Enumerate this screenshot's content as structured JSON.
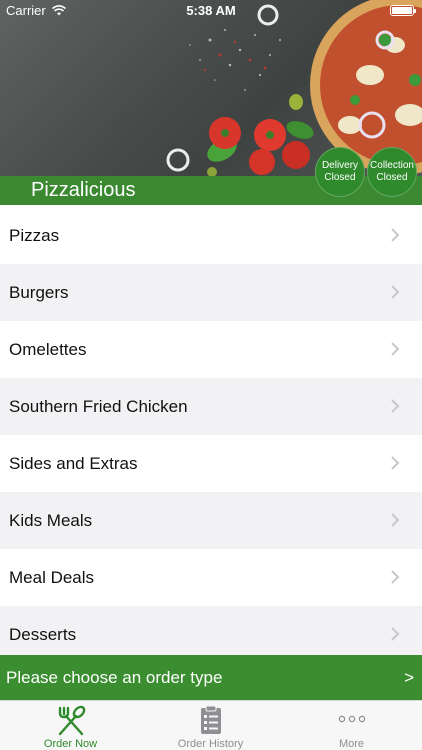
{
  "status_bar": {
    "carrier": "Carrier",
    "time": "5:38 AM",
    "icons": [
      "wifi-icon",
      "battery-icon"
    ]
  },
  "header": {
    "restaurant_name": "Pizzalicious",
    "delivery_badge": {
      "line1": "Delivery",
      "line2": "Closed"
    },
    "collection_badge": {
      "line1": "Collection",
      "line2": "Closed"
    }
  },
  "menu": {
    "items": [
      {
        "label": "Pizzas"
      },
      {
        "label": "Burgers"
      },
      {
        "label": "Omelettes"
      },
      {
        "label": "Southern Fried Chicken"
      },
      {
        "label": "Sides and Extras"
      },
      {
        "label": "Kids Meals"
      },
      {
        "label": "Meal Deals"
      },
      {
        "label": "Desserts"
      }
    ]
  },
  "order_bar": {
    "label": "Please choose an order type",
    "arrow": ">"
  },
  "tabbar": {
    "tabs": [
      {
        "label": "Order Now",
        "icon": "fork-knife-icon",
        "active": true
      },
      {
        "label": "Order History",
        "icon": "clipboard-list-icon",
        "active": false
      },
      {
        "label": "More",
        "icon": "more-dots-icon",
        "active": false
      }
    ]
  },
  "colors": {
    "brand_green": "#3a8e2f",
    "tab_active": "#2f8a2c",
    "tab_inactive": "#8e8e93",
    "list_alt_bg": "#f2f2f4"
  }
}
